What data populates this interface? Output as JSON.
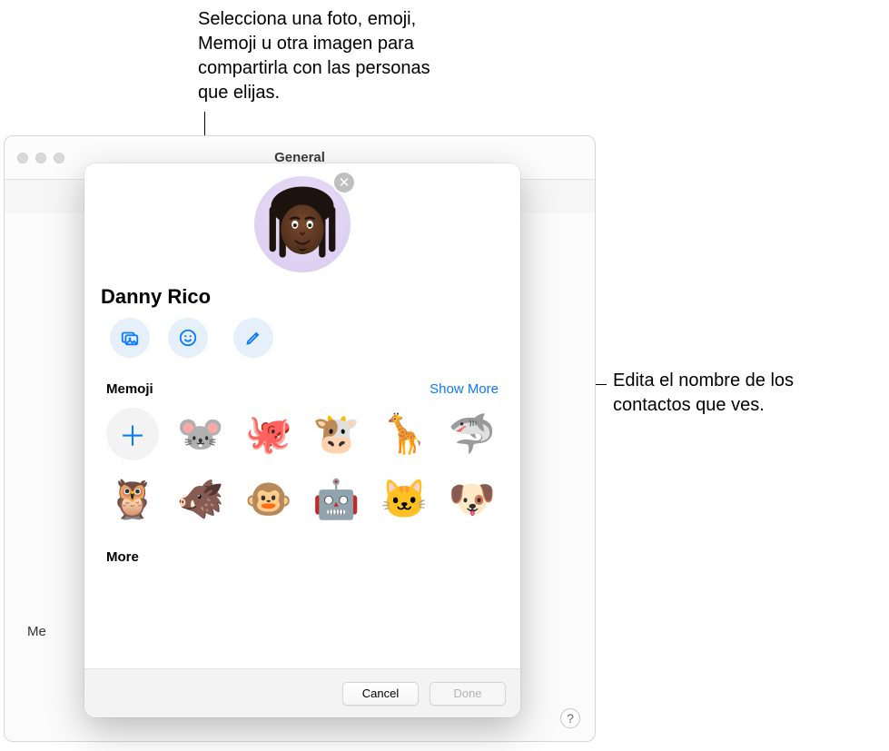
{
  "callouts": {
    "top": "Selecciona una foto, emoji, Memoji u otra imagen para compartirla con las personas que elijas.",
    "right": "Edita el nombre de los contactos que ves."
  },
  "window": {
    "title": "General",
    "bg_partial_label": "Me",
    "help_glyph": "?"
  },
  "modal": {
    "name": "Danny Rico",
    "clear_glyph": "✕",
    "actions": {
      "photo": "photo",
      "emoji": "emoji",
      "edit": "edit"
    },
    "memoji": {
      "title": "Memoji",
      "show_more": "Show More",
      "add_glyph": "＋",
      "items": [
        {
          "name": "mouse",
          "glyph": "🐭"
        },
        {
          "name": "octopus",
          "glyph": "🐙"
        },
        {
          "name": "cow",
          "glyph": "🐮"
        },
        {
          "name": "giraffe",
          "glyph": "🦒"
        },
        {
          "name": "shark",
          "glyph": "🦈"
        },
        {
          "name": "owl",
          "glyph": "🦉"
        },
        {
          "name": "boar",
          "glyph": "🐗"
        },
        {
          "name": "monkey",
          "glyph": "🐵"
        },
        {
          "name": "robot",
          "glyph": "🤖"
        },
        {
          "name": "cat",
          "glyph": "🐱"
        },
        {
          "name": "dog",
          "glyph": "🐶"
        }
      ]
    },
    "more_title": "More",
    "footer": {
      "cancel": "Cancel",
      "done": "Done"
    }
  }
}
